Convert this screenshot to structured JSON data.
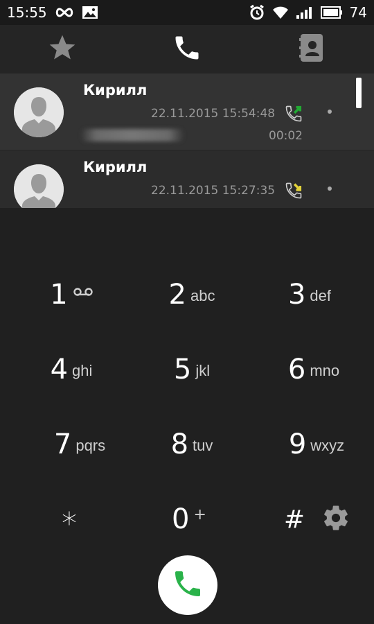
{
  "statusbar": {
    "time": "15:55",
    "battery": "74",
    "icons_left": [
      "infinity-icon",
      "image-icon"
    ],
    "icons_right": [
      "alarm-icon",
      "wifi-icon",
      "signal-icon",
      "battery-icon"
    ]
  },
  "tabs": [
    {
      "name": "favorites",
      "icon": "star-icon"
    },
    {
      "name": "phone",
      "icon": "phone-icon",
      "active": true
    },
    {
      "name": "contacts",
      "icon": "contacts-book-icon"
    }
  ],
  "calls": [
    {
      "name": "Кирилл",
      "datetime": "22.11.2015 15:54:48",
      "duration": "00:02",
      "direction": "outgoing",
      "dir_color": "#22aa33"
    },
    {
      "name": "Кирилл",
      "datetime": "22.11.2015 15:27:35",
      "duration": "",
      "direction": "incoming",
      "dir_color": "#e2d23a"
    }
  ],
  "keypad": [
    {
      "digit": "1",
      "letters": "",
      "icon": "voicemail-icon"
    },
    {
      "digit": "2",
      "letters": "abc"
    },
    {
      "digit": "3",
      "letters": "def"
    },
    {
      "digit": "4",
      "letters": "ghi"
    },
    {
      "digit": "5",
      "letters": "jkl"
    },
    {
      "digit": "6",
      "letters": "mno"
    },
    {
      "digit": "7",
      "letters": "pqrs"
    },
    {
      "digit": "8",
      "letters": "tuv"
    },
    {
      "digit": "9",
      "letters": "wxyz"
    },
    {
      "digit": "*",
      "letters": ""
    },
    {
      "digit": "0",
      "letters": "+"
    },
    {
      "digit": "#",
      "letters": ""
    }
  ],
  "colors": {
    "background": "#202020",
    "call_button": "#2ab24a",
    "incoming": "#e2d23a",
    "outgoing": "#22aa33"
  }
}
